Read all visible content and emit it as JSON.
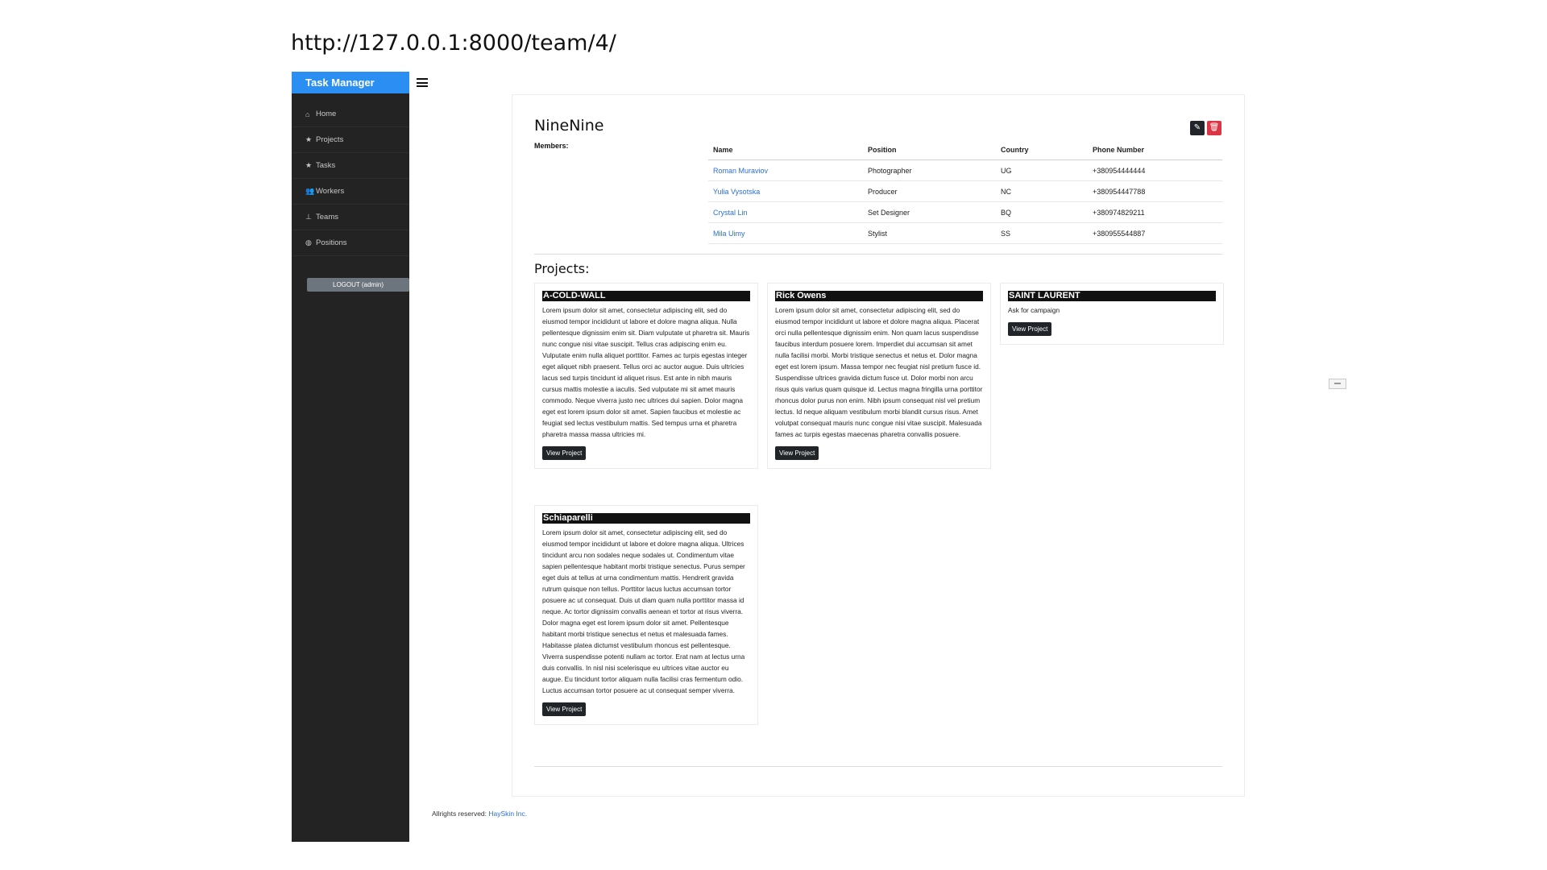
{
  "url": "http://127.0.0.1:8000/team/4/",
  "brand": "Task Manager",
  "nav": [
    {
      "icon": "home-icon",
      "glyph": "⌂",
      "label": "Home"
    },
    {
      "icon": "star-icon",
      "glyph": "★",
      "label": "Projects"
    },
    {
      "icon": "star-icon",
      "glyph": "★",
      "label": "Tasks"
    },
    {
      "icon": "users-icon",
      "glyph": "👥",
      "label": "Workers"
    },
    {
      "icon": "sitemap-icon",
      "glyph": "⊥",
      "label": "Teams"
    },
    {
      "icon": "globe-icon",
      "glyph": "◍",
      "label": "Positions"
    }
  ],
  "logout_label": "LOGOUT (admin)",
  "team": {
    "name": "NineNine",
    "members_label": "Members:"
  },
  "members_table": {
    "headers": [
      "Name",
      "Position",
      "Country",
      "Phone Number"
    ],
    "rows": [
      [
        "Roman Muraviov",
        "Photographer",
        "UG",
        "+380954444444"
      ],
      [
        "Yulia Vysotska",
        "Producer",
        "NC",
        "+380954447788"
      ],
      [
        "Crystal Lin",
        "Set Designer",
        "BQ",
        "+380974829211"
      ],
      [
        "Mila Uimy",
        "Stylist",
        "SS",
        "+380955544887"
      ]
    ]
  },
  "projects_heading": "Projects:",
  "projects": [
    {
      "title": "A-COLD-WALL",
      "description": "Lorem ipsum dolor sit amet, consectetur adipiscing elit, sed do eiusmod tempor incididunt ut labore et dolore magna aliqua. Nulla pellentesque dignissim enim sit. Diam vulputate ut pharetra sit. Mauris nunc congue nisi vitae suscipit. Tellus cras adipiscing enim eu. Vulputate enim nulla aliquet porttitor. Fames ac turpis egestas integer eget aliquet nibh praesent. Tellus orci ac auctor augue. Duis ultricies lacus sed turpis tincidunt id aliquet risus. Est ante in nibh mauris cursus mattis molestie a iaculis. Sed vulputate mi sit amet mauris commodo. Neque viverra justo nec ultrices dui sapien. Dolor magna eget est lorem ipsum dolor sit amet. Sapien faucibus et molestie ac feugiat sed lectus vestibulum mattis. Sed tempus urna et pharetra pharetra massa massa ultricies mi.",
      "button": "View Project"
    },
    {
      "title": "Rick Owens",
      "description": "Lorem ipsum dolor sit amet, consectetur adipiscing elit, sed do eiusmod tempor incididunt ut labore et dolore magna aliqua. Placerat orci nulla pellentesque dignissim enim. Non quam lacus suspendisse faucibus interdum posuere lorem. Imperdiet dui accumsan sit amet nulla facilisi morbi. Morbi tristique senectus et netus et. Dolor magna eget est lorem ipsum. Massa tempor nec feugiat nisl pretium fusce id. Suspendisse ultrices gravida dictum fusce ut. Dolor morbi non arcu risus quis varius quam quisque id. Lectus magna fringilla urna porttitor rhoncus dolor purus non enim. Nibh ipsum consequat nisl vel pretium lectus. Id neque aliquam vestibulum morbi blandit cursus risus. Amet volutpat consequat mauris nunc congue nisi vitae suscipit. Malesuada fames ac turpis egestas maecenas pharetra convallis posuere.",
      "button": "View Project"
    },
    {
      "title": "SAINT LAURENT",
      "description": "Ask for campaign",
      "button": "View Project"
    },
    {
      "title": "Schiaparelli",
      "description": "Lorem ipsum dolor sit amet, consectetur adipiscing elit, sed do eiusmod tempor incididunt ut labore et dolore magna aliqua. Ultrices tincidunt arcu non sodales neque sodales ut. Condimentum vitae sapien pellentesque habitant morbi tristique senectus. Purus semper eget duis at tellus at urna condimentum mattis. Hendrerit gravida rutrum quisque non tellus. Porttitor lacus luctus accumsan tortor posuere ac ut consequat. Duis ut diam quam nulla porttitor massa id neque. Ac tortor dignissim convallis aenean et tortor at risus viverra. Dolor magna eget est lorem ipsum dolor sit amet. Pellentesque habitant morbi tristique senectus et netus et malesuada fames. Habitasse platea dictumst vestibulum rhoncus est pellentesque. Viverra suspendisse potenti nullam ac tortor. Erat nam at lectus urna duis convallis. In nisl nisi scelerisque eu ultrices vitae auctor eu augue. Eu tincidunt tortor aliquam nulla facilisi cras fermentum odio. Luctus accumsan tortor posuere ac ut consequat semper viverra.",
      "button": "View Project"
    }
  ],
  "footer": {
    "text": "Allrights reserved: ",
    "link": "HaySkin Inc."
  },
  "colors": {
    "brand": "#2b8ef2",
    "sidebar": "#232323",
    "delete": "#dc3545",
    "link": "#2b6fd8"
  }
}
